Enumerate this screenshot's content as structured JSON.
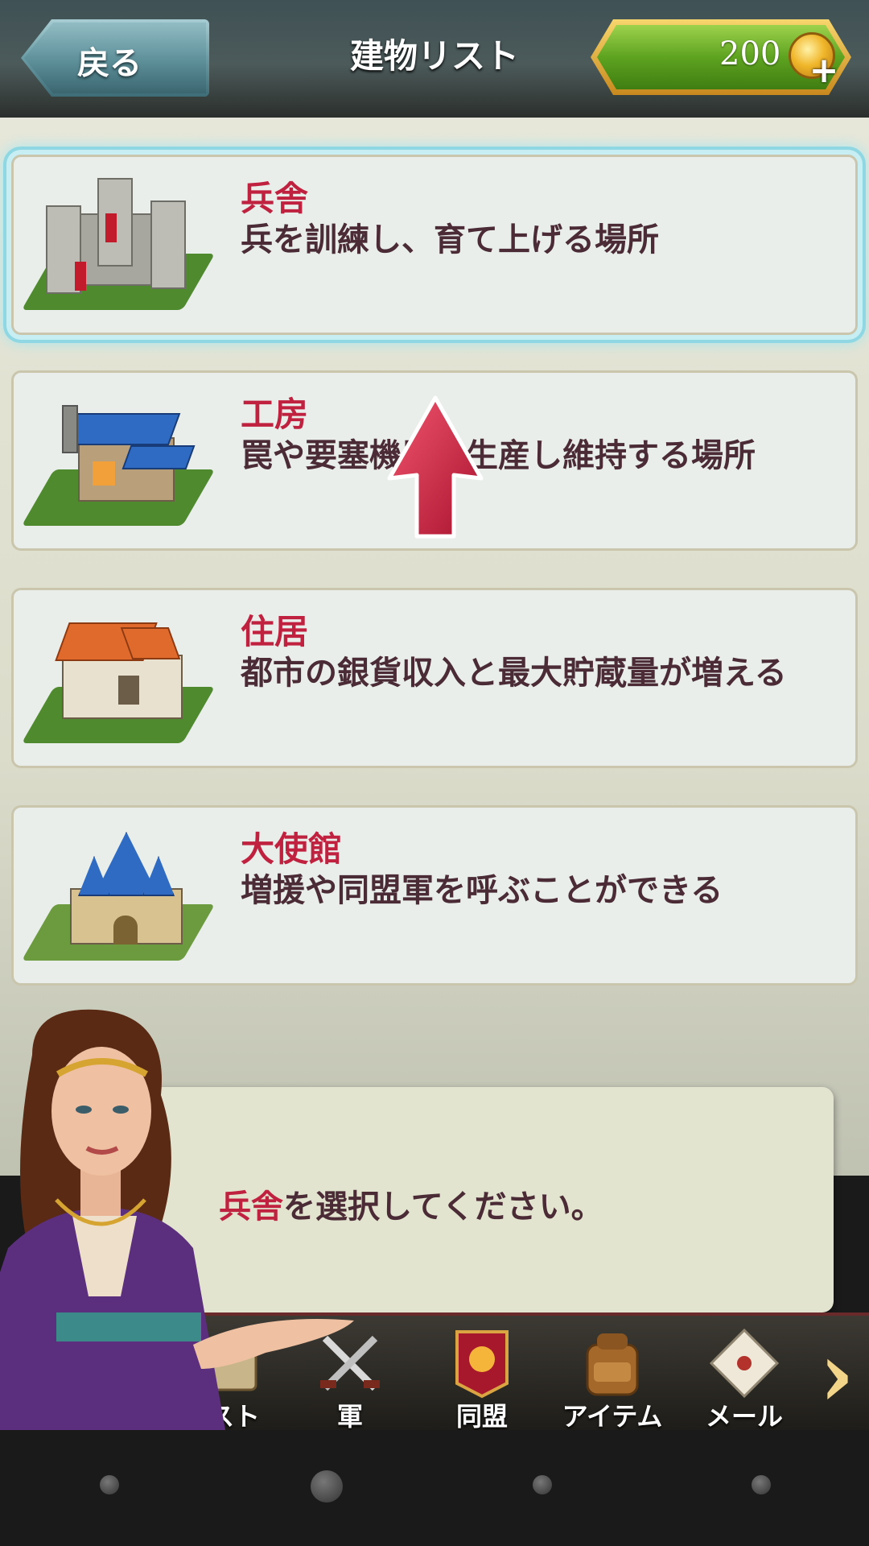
{
  "header": {
    "back_label": "戻る",
    "title": "建物リスト",
    "gold_amount": "200",
    "coin_icon": "gold-coin-icon",
    "add_icon": "plus-icon"
  },
  "buildings": [
    {
      "name": "兵舎",
      "description": "兵を訓練し、育て上げる場所",
      "icon": "barracks-castle-icon",
      "selected": true
    },
    {
      "name": "工房",
      "description": "罠や要塞機器を生産し維持する場所",
      "icon": "workshop-icon",
      "selected": false
    },
    {
      "name": "住居",
      "description": "都市の銀貨収入と最大貯蔵量が増える",
      "icon": "house-icon",
      "selected": false
    },
    {
      "name": "大使館",
      "description": "増援や同盟軍を呼ぶことができる",
      "icon": "embassy-icon",
      "selected": false
    }
  ],
  "hint": {
    "accent": "兵舎",
    "message": "を選択してください。"
  },
  "nav": {
    "items": [
      {
        "label": "スト",
        "icon": "quest-icon"
      },
      {
        "label": "軍",
        "icon": "crossed-swords-icon"
      },
      {
        "label": "同盟",
        "icon": "alliance-banner-icon"
      },
      {
        "label": "アイテム",
        "icon": "backpack-icon"
      },
      {
        "label": "メール",
        "icon": "envelope-icon"
      }
    ],
    "next_icon": "chevron-right-icon"
  },
  "colors": {
    "accent_red": "#c0213f",
    "text_dark": "#4a2b36",
    "gold_green": "#5ea320",
    "selection_glow": "#8ed7e3"
  }
}
